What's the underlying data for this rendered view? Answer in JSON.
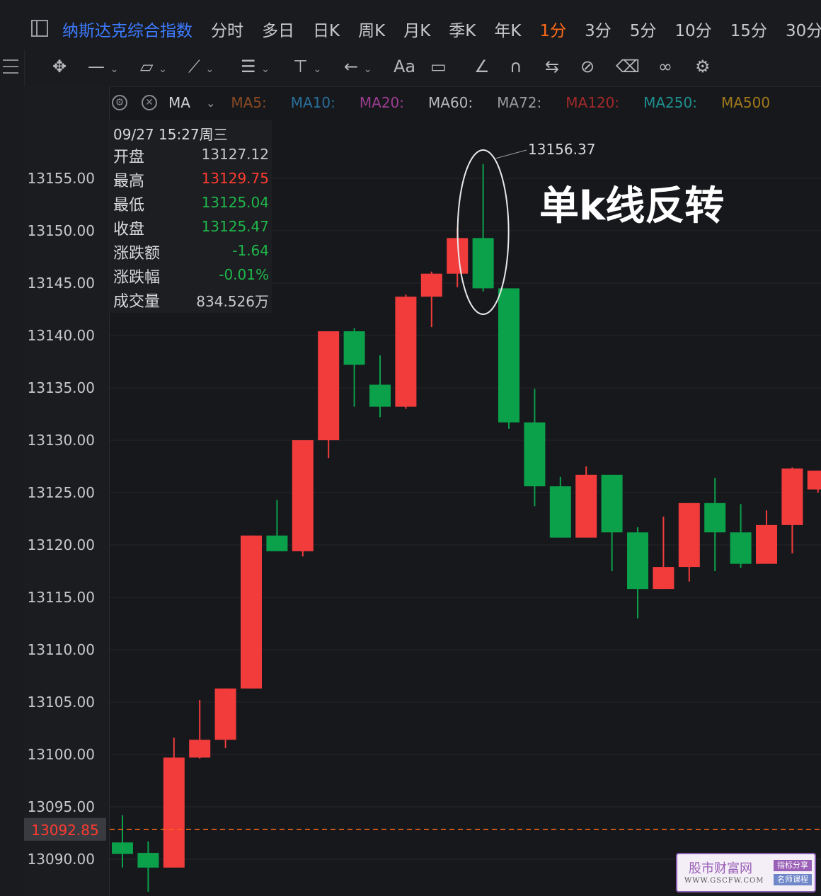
{
  "header": {
    "title": "纳斯达克综合指数",
    "periods": [
      "分时",
      "多日",
      "日K",
      "周K",
      "月K",
      "季K",
      "年K",
      "1分",
      "3分",
      "5分",
      "10分",
      "15分",
      "30分"
    ],
    "active_period": "1分"
  },
  "toolbar": {
    "icons": [
      "move-icon",
      "line-style-icon",
      "rect-icon",
      "polyline-icon",
      "fib-icon",
      "price-line-icon",
      "arrow-icon",
      "text-icon",
      "comment-icon",
      "pencil-icon",
      "magnet-icon",
      "sync-icon",
      "hide-icon",
      "trash-icon",
      "link-icon",
      "settings-icon"
    ],
    "text_label": "Aa"
  },
  "ma_bar": {
    "label": "MA",
    "items": [
      {
        "label": "MA5:",
        "color": "#8a4a24"
      },
      {
        "label": "MA10:",
        "color": "#2a6f9a"
      },
      {
        "label": "MA20:",
        "color": "#9a3d8f"
      },
      {
        "label": "MA60:",
        "color": "#b7b8bb"
      },
      {
        "label": "MA72:",
        "color": "#9a9b9e"
      },
      {
        "label": "MA120:",
        "color": "#a02a2a"
      },
      {
        "label": "MA250:",
        "color": "#1f8f8f"
      },
      {
        "label": "MA500",
        "color": "#a07a1a"
      }
    ]
  },
  "info_panel": {
    "datetime": "09/27 15:27周三",
    "rows": [
      {
        "key": "开盘",
        "value": "13127.12",
        "color": "#c8c9cc"
      },
      {
        "key": "最高",
        "value": "13129.75",
        "color": "#ff3b30"
      },
      {
        "key": "最低",
        "value": "13125.04",
        "color": "#1fb84a"
      },
      {
        "key": "收盘",
        "value": "13125.47",
        "color": "#1fb84a"
      },
      {
        "key": "涨跌额",
        "value": "-1.64",
        "color": "#1fb84a"
      },
      {
        "key": "涨跌幅",
        "value": "-0.01%",
        "color": "#1fb84a"
      },
      {
        "key": "成交量",
        "value": "834.526万",
        "color": "#c8c9cc"
      }
    ]
  },
  "annotation": {
    "text": "单k线反转",
    "peak_label": "13156.37"
  },
  "current_price_label": "13092.85",
  "watermark": {
    "name": "股市财富网",
    "url": "WWW.GSCFW.COM",
    "tag1": "指标分享",
    "tag2": "名师课程"
  },
  "colors": {
    "up": "#f23c3c",
    "down": "#0aa14a",
    "bg": "#17181c",
    "grid": "#24252a",
    "dashed": "#ff6a1a"
  },
  "chart_data": {
    "type": "candlestick",
    "ylim": [
      13087.5,
      13160.5
    ],
    "y_ticks": [
      13155,
      13150,
      13145,
      13140,
      13135,
      13130,
      13125,
      13120,
      13115,
      13110,
      13105,
      13100,
      13095,
      13090
    ],
    "y_tick_labels": [
      "13155.00",
      "13150.00",
      "13145.00",
      "13140.00",
      "13135.00",
      "13130.00",
      "13125.00",
      "13120.00",
      "13115.00",
      "13110.00",
      "13105.00",
      "13100.00",
      "13095.00",
      "13090.00"
    ],
    "current_price": 13092.85,
    "candles": [
      {
        "o": 13091.6,
        "h": 13094.2,
        "l": 13089.2,
        "c": 13090.5
      },
      {
        "o": 13090.6,
        "h": 13091.7,
        "l": 13086.9,
        "c": 13089.2
      },
      {
        "o": 13089.2,
        "h": 13101.6,
        "l": 13089.2,
        "c": 13099.7
      },
      {
        "o": 13099.7,
        "h": 13105.2,
        "l": 13099.6,
        "c": 13101.4
      },
      {
        "o": 13101.4,
        "h": 13106.3,
        "l": 13100.6,
        "c": 13106.3
      },
      {
        "o": 13106.3,
        "h": 13120.9,
        "l": 13106.3,
        "c": 13120.9
      },
      {
        "o": 13120.9,
        "h": 13124.3,
        "l": 13119.4,
        "c": 13119.4
      },
      {
        "o": 13119.4,
        "h": 13130.0,
        "l": 13118.9,
        "c": 13130.0
      },
      {
        "o": 13130.0,
        "h": 13140.4,
        "l": 13128.3,
        "c": 13140.4
      },
      {
        "o": 13140.4,
        "h": 13140.7,
        "l": 13133.2,
        "c": 13137.2
      },
      {
        "o": 13135.3,
        "h": 13138.1,
        "l": 13132.2,
        "c": 13133.2
      },
      {
        "o": 13133.2,
        "h": 13143.9,
        "l": 13133.0,
        "c": 13143.7
      },
      {
        "o": 13143.7,
        "h": 13146.1,
        "l": 13140.8,
        "c": 13145.9
      },
      {
        "o": 13145.9,
        "h": 13150.3,
        "l": 13144.6,
        "c": 13149.3
      },
      {
        "o": 13149.3,
        "h": 13156.37,
        "l": 13144.2,
        "c": 13144.5
      },
      {
        "o": 13144.5,
        "h": 13144.5,
        "l": 13131.1,
        "c": 13131.7
      },
      {
        "o": 13131.7,
        "h": 13134.9,
        "l": 13123.7,
        "c": 13125.6
      },
      {
        "o": 13125.6,
        "h": 13126.5,
        "l": 13120.7,
        "c": 13120.7
      },
      {
        "o": 13120.7,
        "h": 13127.5,
        "l": 13120.7,
        "c": 13126.7
      },
      {
        "o": 13126.7,
        "h": 13126.7,
        "l": 13117.5,
        "c": 13121.2
      },
      {
        "o": 13121.2,
        "h": 13121.7,
        "l": 13113.0,
        "c": 13115.8
      },
      {
        "o": 13115.8,
        "h": 13122.7,
        "l": 13115.8,
        "c": 13117.9
      },
      {
        "o": 13117.9,
        "h": 13124.0,
        "l": 13116.5,
        "c": 13124.0
      },
      {
        "o": 13124.0,
        "h": 13126.4,
        "l": 13117.5,
        "c": 13121.2
      },
      {
        "o": 13121.2,
        "h": 13123.9,
        "l": 13117.8,
        "c": 13118.2
      },
      {
        "o": 13118.2,
        "h": 13123.3,
        "l": 13118.2,
        "c": 13121.9
      },
      {
        "o": 13121.9,
        "h": 13127.4,
        "l": 13119.2,
        "c": 13127.3
      },
      {
        "o": 13125.3,
        "h": 13127.1,
        "l": 13125.0,
        "c": 13127.1
      }
    ]
  }
}
